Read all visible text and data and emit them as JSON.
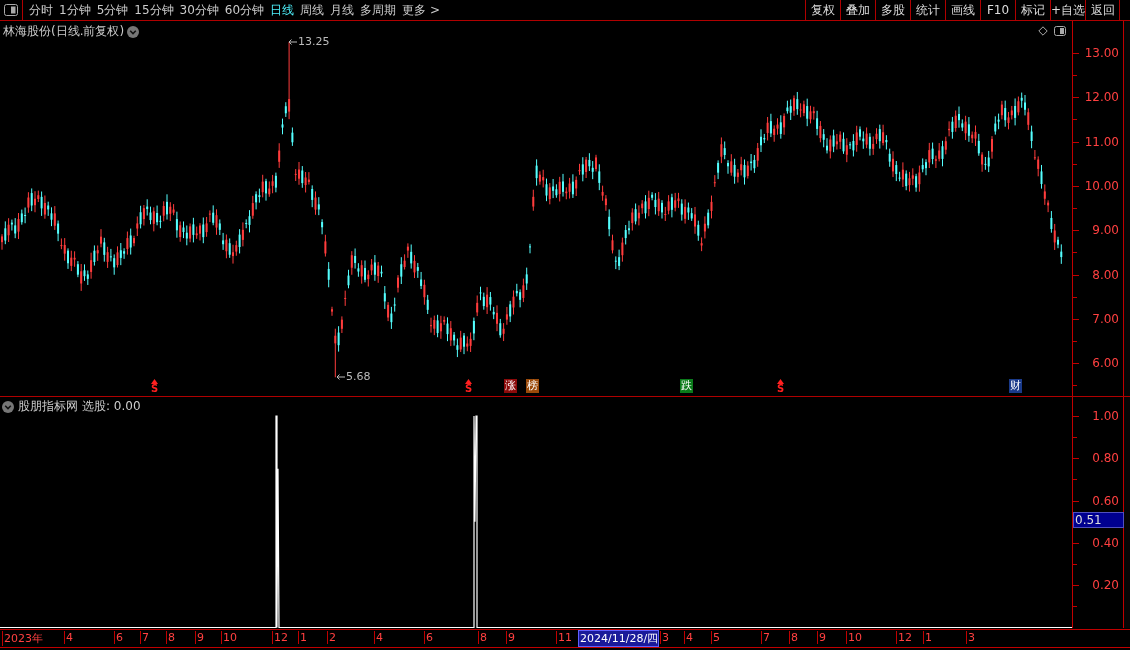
{
  "toolbar": {
    "tabs": [
      {
        "label": "分时",
        "selected": false
      },
      {
        "label": "1分钟",
        "selected": false
      },
      {
        "label": "5分钟",
        "selected": false
      },
      {
        "label": "15分钟",
        "selected": false
      },
      {
        "label": "30分钟",
        "selected": false
      },
      {
        "label": "60分钟",
        "selected": false
      },
      {
        "label": "日线",
        "selected": true
      },
      {
        "label": "周线",
        "selected": false
      },
      {
        "label": "月线",
        "selected": false
      },
      {
        "label": "多周期",
        "selected": false
      },
      {
        "label": "更多 >",
        "selected": false
      }
    ],
    "actions": [
      "复权",
      "叠加",
      "多股",
      "统计",
      "画线",
      "F10",
      "标记",
      "+自选",
      "返回"
    ]
  },
  "chart": {
    "title": "林海股份(日线.前复权)",
    "price_ticks": [
      "13.00",
      "12.00",
      "11.00",
      "10.00",
      "9.00",
      "8.00",
      "7.00",
      "6.00"
    ],
    "high_label": "13.25",
    "low_label": "5.68",
    "markers": [
      {
        "kind": "signal",
        "label": "S"
      },
      {
        "kind": "signal",
        "label": "S"
      },
      {
        "kind": "tag",
        "label": "涨",
        "color": "#8b0a0a"
      },
      {
        "kind": "tag",
        "label": "榜",
        "color": "#9a4a0a"
      },
      {
        "kind": "tag",
        "label": "跌",
        "color": "#0a7a1a"
      },
      {
        "kind": "signal",
        "label": "S"
      },
      {
        "kind": "tag",
        "label": "财",
        "color": "#1a3a8a"
      }
    ]
  },
  "indicator": {
    "name": "股朋指标网",
    "reading": "选股: 0.00",
    "ticks": [
      "1.00",
      "0.80",
      "0.60",
      "0.40",
      "0.20"
    ],
    "current": "0.51"
  },
  "date_axis": {
    "labels": [
      {
        "label": "2023年",
        "selected": false
      },
      {
        "label": "4",
        "selected": false
      },
      {
        "label": "6",
        "selected": false
      },
      {
        "label": "7",
        "selected": false
      },
      {
        "label": "8",
        "selected": false
      },
      {
        "label": "9",
        "selected": false
      },
      {
        "label": "10",
        "selected": false
      },
      {
        "label": "12",
        "selected": false
      },
      {
        "label": "1",
        "selected": false
      },
      {
        "label": "2",
        "selected": false
      },
      {
        "label": "4",
        "selected": false
      },
      {
        "label": "6",
        "selected": false
      },
      {
        "label": "8",
        "selected": false
      },
      {
        "label": "9",
        "selected": false
      },
      {
        "label": "11",
        "selected": false
      },
      {
        "label": "2024/11/28/四",
        "selected": true
      },
      {
        "label": "3",
        "selected": false
      },
      {
        "label": "4",
        "selected": false
      },
      {
        "label": "5",
        "selected": false
      },
      {
        "label": "7",
        "selected": false
      },
      {
        "label": "8",
        "selected": false
      },
      {
        "label": "9",
        "selected": false
      },
      {
        "label": "10",
        "selected": false
      },
      {
        "label": "12",
        "selected": false
      },
      {
        "label": "1",
        "selected": false
      },
      {
        "label": "3",
        "selected": false
      }
    ]
  }
}
